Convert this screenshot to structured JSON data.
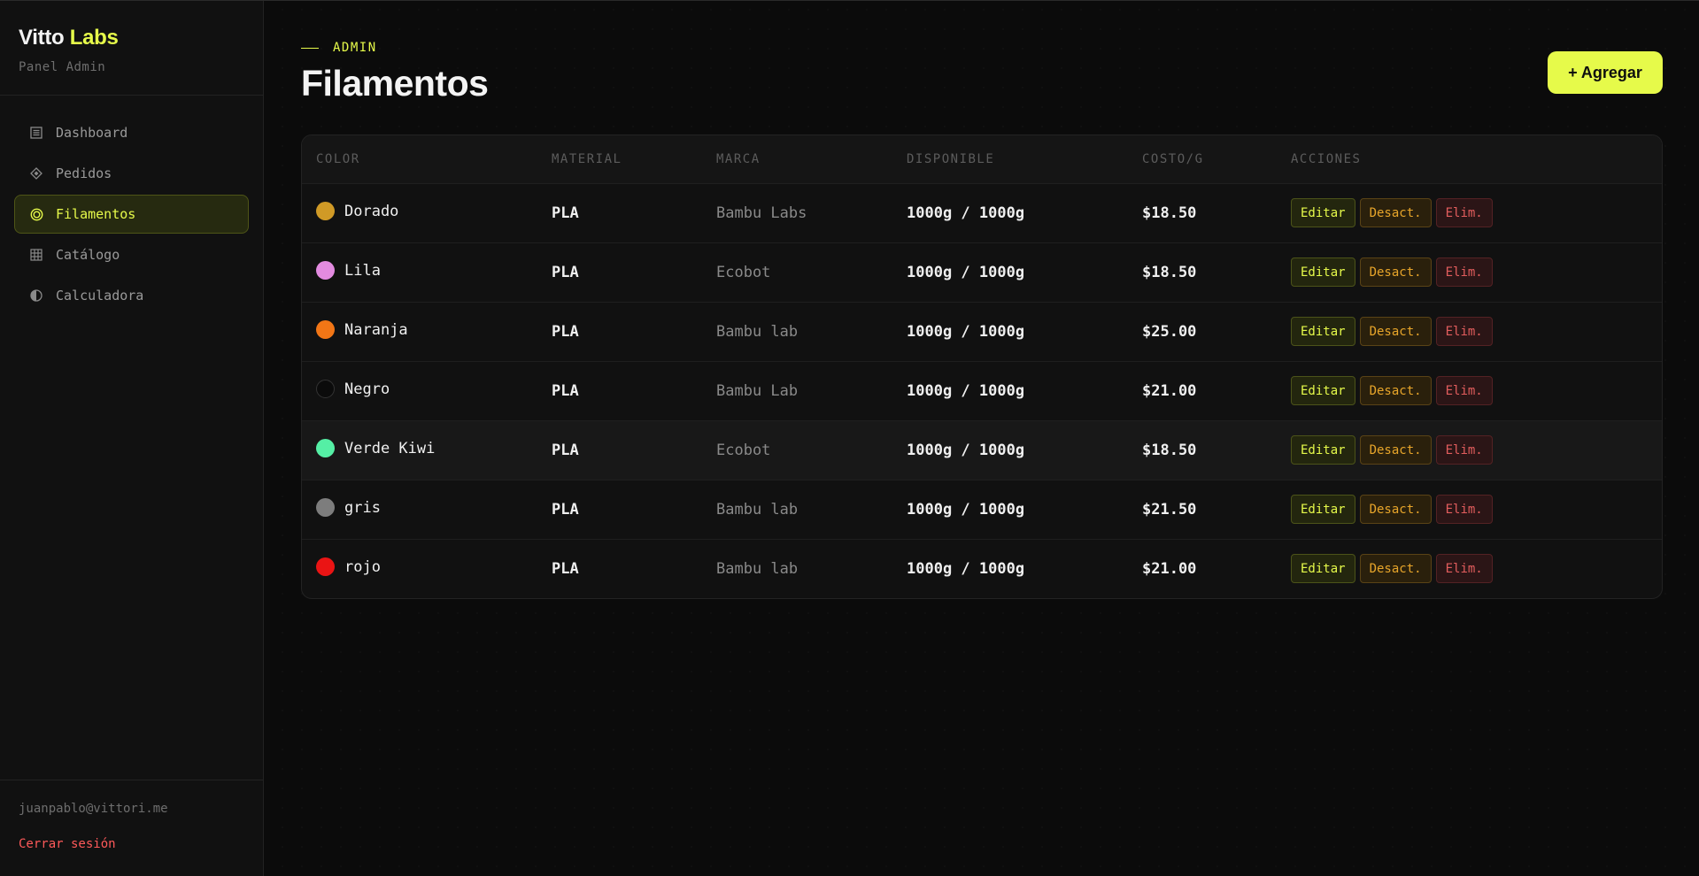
{
  "sidebar": {
    "brand_main": "Vitto",
    "brand_accent": "Labs",
    "subtitle": "Panel Admin",
    "items": [
      {
        "label": "Dashboard",
        "icon": "list-icon"
      },
      {
        "label": "Pedidos",
        "icon": "diamond-icon"
      },
      {
        "label": "Filamentos",
        "icon": "spool-icon",
        "active": true
      },
      {
        "label": "Catálogo",
        "icon": "grid-icon"
      },
      {
        "label": "Calculadora",
        "icon": "half-circle-icon"
      }
    ],
    "email": "juanpablo@vittori.me",
    "logout": "Cerrar sesión"
  },
  "header": {
    "eyebrow": "ADMIN",
    "title": "Filamentos",
    "add_button": "+ Agregar"
  },
  "table": {
    "columns": [
      "COLOR",
      "MATERIAL",
      "MARCA",
      "DISPONIBLE",
      "COSTO/G",
      "ACCIONES"
    ],
    "actions": {
      "edit": "Editar",
      "deactivate": "Desact.",
      "delete": "Elim."
    },
    "rows": [
      {
        "color": "Dorado",
        "swatch": "#d09a26",
        "material": "PLA",
        "brand": "Bambu Labs",
        "available": "1000g / 1000g",
        "cost": "$18.50"
      },
      {
        "color": "Lila",
        "swatch": "#e38be0",
        "material": "PLA",
        "brand": "Ecobot",
        "available": "1000g / 1000g",
        "cost": "$18.50"
      },
      {
        "color": "Naranja",
        "swatch": "#f27616",
        "material": "PLA",
        "brand": "Bambu lab",
        "available": "1000g / 1000g",
        "cost": "$25.00"
      },
      {
        "color": "Negro",
        "swatch": "#0b0b0b",
        "material": "PLA",
        "brand": "Bambu Lab",
        "available": "1000g / 1000g",
        "cost": "$21.00"
      },
      {
        "color": "Verde Kiwi",
        "swatch": "#55efa5",
        "material": "PLA",
        "brand": "Ecobot",
        "available": "1000g / 1000g",
        "cost": "$18.50"
      },
      {
        "color": "gris",
        "swatch": "#7d7d7d",
        "material": "PLA",
        "brand": "Bambu lab",
        "available": "1000g / 1000g",
        "cost": "$21.50"
      },
      {
        "color": "rojo",
        "swatch": "#ea1414",
        "material": "PLA",
        "brand": "Bambu lab",
        "available": "1000g / 1000g",
        "cost": "$21.00"
      }
    ]
  },
  "colors": {
    "accent": "#e6fa4a",
    "warning": "#e7a52a",
    "danger": "#e25d5d",
    "logout": "#ff5a5a"
  }
}
